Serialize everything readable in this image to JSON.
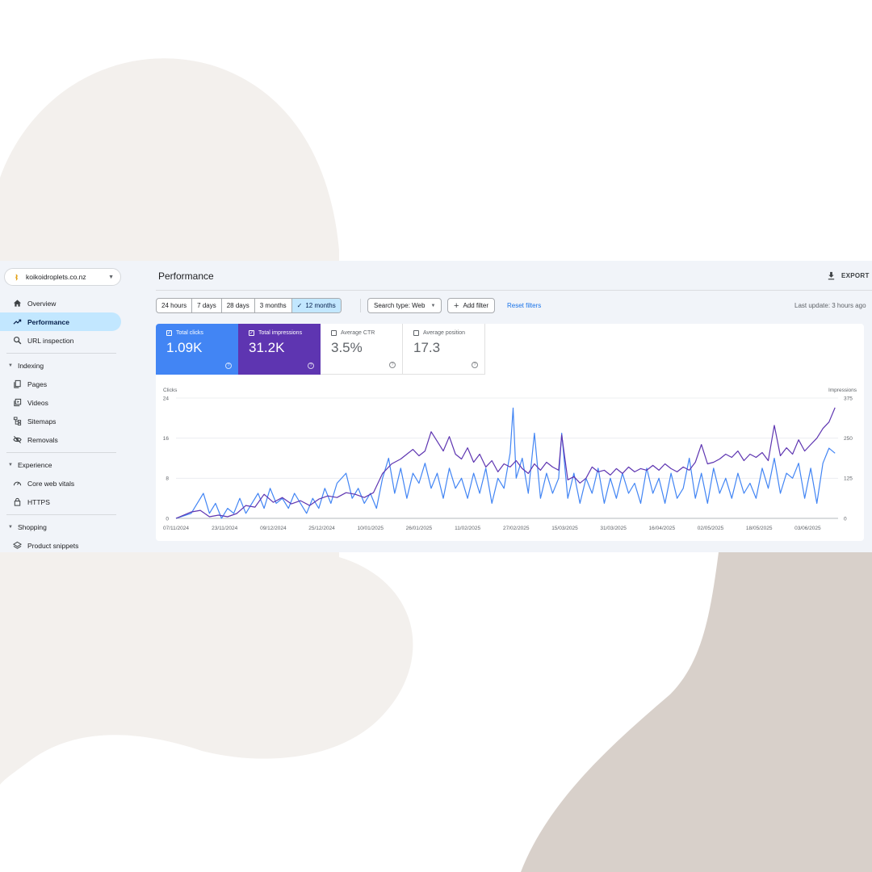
{
  "property": {
    "name": "koikoidroplets.co.nz",
    "logo_color": "#e3a21a"
  },
  "sidebar": {
    "items_top": [
      {
        "label": "Overview",
        "icon": "home-icon"
      },
      {
        "label": "Performance",
        "icon": "trending-up-icon",
        "active": true
      },
      {
        "label": "URL inspection",
        "icon": "search-icon"
      }
    ],
    "indexing": {
      "label": "Indexing",
      "items": [
        {
          "label": "Pages",
          "icon": "pages-icon"
        },
        {
          "label": "Videos",
          "icon": "video-icon"
        },
        {
          "label": "Sitemaps",
          "icon": "sitemap-icon"
        },
        {
          "label": "Removals",
          "icon": "eye-off-icon"
        }
      ]
    },
    "experience": {
      "label": "Experience",
      "items": [
        {
          "label": "Core web vitals",
          "icon": "gauge-icon"
        },
        {
          "label": "HTTPS",
          "icon": "lock-icon"
        }
      ]
    },
    "shopping": {
      "label": "Shopping",
      "items": [
        {
          "label": "Product snippets",
          "icon": "layers-icon"
        }
      ]
    }
  },
  "header": {
    "title": "Performance",
    "export_label": "EXPORT",
    "ranges": [
      "24 hours",
      "7 days",
      "28 days",
      "3 months",
      "12 months"
    ],
    "selected_range": "12 months",
    "search_type": "Search type: Web",
    "add_filter": "Add filter",
    "reset_filters": "Reset filters",
    "last_update": "Last update: 3 hours ago"
  },
  "metrics": {
    "clicks": {
      "label": "Total clicks",
      "value": "1.09K",
      "color": "#4285f4"
    },
    "impressions": {
      "label": "Total impressions",
      "value": "31.2K",
      "color": "#5e35b1"
    },
    "ctr": {
      "label": "Average CTR",
      "value": "3.5%"
    },
    "position": {
      "label": "Average position",
      "value": "17.3"
    }
  },
  "chart_data": {
    "type": "line",
    "title": "",
    "y_left_label": "Clicks",
    "y_right_label": "Impressions",
    "y_left_ticks": [
      "0",
      "8",
      "16",
      "24"
    ],
    "y_right_ticks": [
      "0",
      "125",
      "250",
      "375"
    ],
    "y_left_range": [
      0,
      24
    ],
    "y_right_range": [
      0,
      375
    ],
    "x_tick_labels": [
      "07/11/2024",
      "23/11/2024",
      "09/12/2024",
      "25/12/2024",
      "10/01/2025",
      "26/01/2025",
      "11/02/2025",
      "27/02/2025",
      "15/03/2025",
      "31/03/2025",
      "16/04/2025",
      "02/05/2025",
      "18/05/2025",
      "03/06/2025"
    ],
    "x_range": [
      "07/11/2024",
      "13/06/2025"
    ],
    "grid": true,
    "series": [
      {
        "name": "Clicks",
        "color": "#4285f4",
        "axis": "left",
        "points": [
          [
            "07/11/2024",
            0
          ],
          [
            "12/11/2024",
            1
          ],
          [
            "14/11/2024",
            3
          ],
          [
            "16/11/2024",
            5
          ],
          [
            "18/11/2024",
            1
          ],
          [
            "20/11/2024",
            3
          ],
          [
            "22/11/2024",
            0
          ],
          [
            "24/11/2024",
            2
          ],
          [
            "26/11/2024",
            1
          ],
          [
            "28/11/2024",
            4
          ],
          [
            "30/11/2024",
            1
          ],
          [
            "02/12/2024",
            3
          ],
          [
            "04/12/2024",
            5
          ],
          [
            "06/12/2024",
            2
          ],
          [
            "08/12/2024",
            6
          ],
          [
            "10/12/2024",
            3
          ],
          [
            "12/12/2024",
            4
          ],
          [
            "14/12/2024",
            2
          ],
          [
            "16/12/2024",
            5
          ],
          [
            "18/12/2024",
            3
          ],
          [
            "20/12/2024",
            1
          ],
          [
            "22/12/2024",
            4
          ],
          [
            "24/12/2024",
            2
          ],
          [
            "26/12/2024",
            6
          ],
          [
            "28/12/2024",
            3
          ],
          [
            "30/12/2024",
            7
          ],
          [
            "02/01/2025",
            9
          ],
          [
            "04/01/2025",
            4
          ],
          [
            "06/01/2025",
            6
          ],
          [
            "08/01/2025",
            3
          ],
          [
            "10/01/2025",
            5
          ],
          [
            "12/01/2025",
            2
          ],
          [
            "14/01/2025",
            8
          ],
          [
            "16/01/2025",
            12
          ],
          [
            "18/01/2025",
            5
          ],
          [
            "20/01/2025",
            10
          ],
          [
            "22/01/2025",
            4
          ],
          [
            "24/01/2025",
            9
          ],
          [
            "26/01/2025",
            7
          ],
          [
            "28/01/2025",
            11
          ],
          [
            "30/01/2025",
            6
          ],
          [
            "01/02/2025",
            9
          ],
          [
            "03/02/2025",
            4
          ],
          [
            "05/02/2025",
            10
          ],
          [
            "07/02/2025",
            6
          ],
          [
            "09/02/2025",
            8
          ],
          [
            "11/02/2025",
            4
          ],
          [
            "13/02/2025",
            9
          ],
          [
            "15/02/2025",
            5
          ],
          [
            "17/02/2025",
            10
          ],
          [
            "19/02/2025",
            3
          ],
          [
            "21/02/2025",
            8
          ],
          [
            "23/02/2025",
            6
          ],
          [
            "25/02/2025",
            13
          ],
          [
            "26/02/2025",
            22
          ],
          [
            "27/02/2025",
            8
          ],
          [
            "01/03/2025",
            12
          ],
          [
            "03/03/2025",
            5
          ],
          [
            "05/03/2025",
            17
          ],
          [
            "07/03/2025",
            4
          ],
          [
            "09/03/2025",
            9
          ],
          [
            "11/03/2025",
            5
          ],
          [
            "13/03/2025",
            8
          ],
          [
            "14/03/2025",
            17
          ],
          [
            "16/03/2025",
            4
          ],
          [
            "18/03/2025",
            9
          ],
          [
            "20/03/2025",
            3
          ],
          [
            "22/03/2025",
            8
          ],
          [
            "24/03/2025",
            5
          ],
          [
            "26/03/2025",
            10
          ],
          [
            "28/03/2025",
            3
          ],
          [
            "30/03/2025",
            8
          ],
          [
            "01/04/2025",
            4
          ],
          [
            "03/04/2025",
            9
          ],
          [
            "05/04/2025",
            5
          ],
          [
            "07/04/2025",
            7
          ],
          [
            "09/04/2025",
            3
          ],
          [
            "11/04/2025",
            10
          ],
          [
            "13/04/2025",
            5
          ],
          [
            "15/04/2025",
            8
          ],
          [
            "17/04/2025",
            3
          ],
          [
            "19/04/2025",
            9
          ],
          [
            "21/04/2025",
            4
          ],
          [
            "23/04/2025",
            6
          ],
          [
            "25/04/2025",
            12
          ],
          [
            "27/04/2025",
            4
          ],
          [
            "29/04/2025",
            9
          ],
          [
            "01/05/2025",
            3
          ],
          [
            "03/05/2025",
            10
          ],
          [
            "05/05/2025",
            5
          ],
          [
            "07/05/2025",
            8
          ],
          [
            "09/05/2025",
            4
          ],
          [
            "11/05/2025",
            9
          ],
          [
            "13/05/2025",
            5
          ],
          [
            "15/05/2025",
            7
          ],
          [
            "17/05/2025",
            4
          ],
          [
            "19/05/2025",
            10
          ],
          [
            "21/05/2025",
            6
          ],
          [
            "23/05/2025",
            12
          ],
          [
            "25/05/2025",
            5
          ],
          [
            "27/05/2025",
            9
          ],
          [
            "29/05/2025",
            8
          ],
          [
            "31/05/2025",
            11
          ],
          [
            "02/06/2025",
            4
          ],
          [
            "04/06/2025",
            10
          ],
          [
            "06/06/2025",
            3
          ],
          [
            "08/06/2025",
            11
          ],
          [
            "10/06/2025",
            14
          ],
          [
            "12/06/2025",
            13
          ]
        ]
      },
      {
        "name": "Impressions",
        "color": "#5e35b1",
        "axis": "right",
        "points": [
          [
            "07/11/2024",
            0
          ],
          [
            "12/11/2024",
            20
          ],
          [
            "15/11/2024",
            25
          ],
          [
            "18/11/2024",
            5
          ],
          [
            "21/11/2024",
            10
          ],
          [
            "24/11/2024",
            5
          ],
          [
            "27/11/2024",
            15
          ],
          [
            "30/11/2024",
            40
          ],
          [
            "03/12/2024",
            35
          ],
          [
            "06/12/2024",
            75
          ],
          [
            "09/12/2024",
            50
          ],
          [
            "12/12/2024",
            65
          ],
          [
            "15/12/2024",
            45
          ],
          [
            "18/12/2024",
            55
          ],
          [
            "21/12/2024",
            40
          ],
          [
            "24/12/2024",
            60
          ],
          [
            "27/12/2024",
            70
          ],
          [
            "30/12/2024",
            65
          ],
          [
            "02/01/2025",
            80
          ],
          [
            "05/01/2025",
            75
          ],
          [
            "08/01/2025",
            65
          ],
          [
            "11/01/2025",
            80
          ],
          [
            "14/01/2025",
            140
          ],
          [
            "17/01/2025",
            170
          ],
          [
            "20/01/2025",
            185
          ],
          [
            "22/01/2025",
            200
          ],
          [
            "24/01/2025",
            215
          ],
          [
            "26/01/2025",
            195
          ],
          [
            "28/01/2025",
            210
          ],
          [
            "30/01/2025",
            270
          ],
          [
            "01/02/2025",
            240
          ],
          [
            "03/02/2025",
            210
          ],
          [
            "05/02/2025",
            255
          ],
          [
            "07/02/2025",
            200
          ],
          [
            "09/02/2025",
            185
          ],
          [
            "11/02/2025",
            220
          ],
          [
            "13/02/2025",
            175
          ],
          [
            "15/02/2025",
            200
          ],
          [
            "17/02/2025",
            160
          ],
          [
            "19/02/2025",
            180
          ],
          [
            "21/02/2025",
            145
          ],
          [
            "23/02/2025",
            170
          ],
          [
            "25/02/2025",
            160
          ],
          [
            "27/02/2025",
            180
          ],
          [
            "01/03/2025",
            155
          ],
          [
            "03/03/2025",
            140
          ],
          [
            "05/03/2025",
            170
          ],
          [
            "07/03/2025",
            150
          ],
          [
            "09/03/2025",
            175
          ],
          [
            "11/03/2025",
            160
          ],
          [
            "13/03/2025",
            150
          ],
          [
            "14/03/2025",
            260
          ],
          [
            "16/03/2025",
            120
          ],
          [
            "18/03/2025",
            130
          ],
          [
            "20/03/2025",
            110
          ],
          [
            "22/03/2025",
            125
          ],
          [
            "24/03/2025",
            160
          ],
          [
            "26/03/2025",
            145
          ],
          [
            "28/03/2025",
            150
          ],
          [
            "30/03/2025",
            135
          ],
          [
            "01/04/2025",
            155
          ],
          [
            "03/04/2025",
            140
          ],
          [
            "05/04/2025",
            160
          ],
          [
            "07/04/2025",
            145
          ],
          [
            "09/04/2025",
            155
          ],
          [
            "11/04/2025",
            150
          ],
          [
            "13/04/2025",
            165
          ],
          [
            "15/04/2025",
            150
          ],
          [
            "17/04/2025",
            170
          ],
          [
            "19/04/2025",
            155
          ],
          [
            "21/04/2025",
            145
          ],
          [
            "23/04/2025",
            160
          ],
          [
            "25/04/2025",
            150
          ],
          [
            "27/04/2025",
            175
          ],
          [
            "29/04/2025",
            230
          ],
          [
            "01/05/2025",
            170
          ],
          [
            "03/05/2025",
            175
          ],
          [
            "05/05/2025",
            185
          ],
          [
            "07/05/2025",
            200
          ],
          [
            "09/05/2025",
            190
          ],
          [
            "11/05/2025",
            210
          ],
          [
            "13/05/2025",
            180
          ],
          [
            "15/05/2025",
            200
          ],
          [
            "17/05/2025",
            190
          ],
          [
            "19/05/2025",
            205
          ],
          [
            "21/05/2025",
            180
          ],
          [
            "23/05/2025",
            290
          ],
          [
            "25/05/2025",
            195
          ],
          [
            "27/05/2025",
            220
          ],
          [
            "29/05/2025",
            200
          ],
          [
            "31/05/2025",
            245
          ],
          [
            "02/06/2025",
            210
          ],
          [
            "04/06/2025",
            230
          ],
          [
            "06/06/2025",
            250
          ],
          [
            "08/06/2025",
            280
          ],
          [
            "10/06/2025",
            300
          ],
          [
            "12/06/2025",
            345
          ]
        ]
      }
    ]
  }
}
